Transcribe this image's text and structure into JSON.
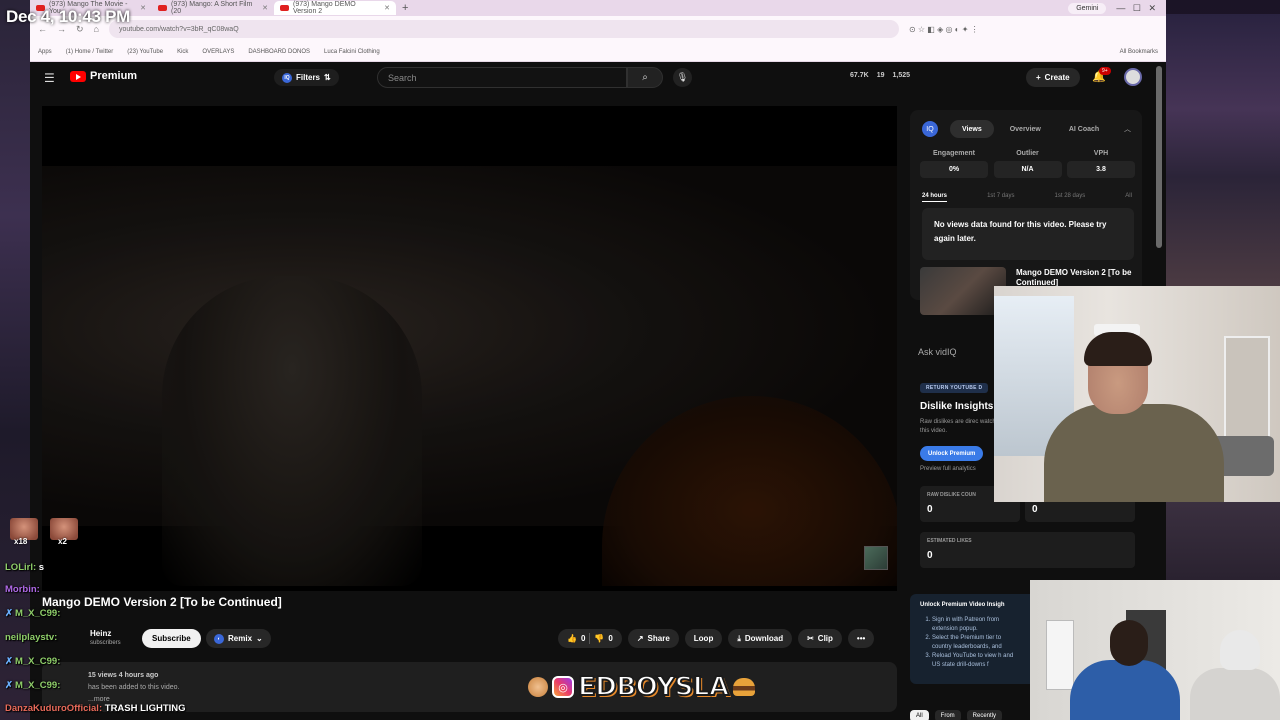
{
  "overlay": {
    "timestamp": "Dec 4, 10:43 PM"
  },
  "browser": {
    "tabs": [
      {
        "title": "(973) Mango The Movie - You",
        "active": false
      },
      {
        "title": "(973) Mango: A Short Film (20",
        "active": false
      },
      {
        "title": "(973) Mango DEMO Version 2",
        "active": true
      }
    ],
    "gemini": "Gemini",
    "url": "youtube.com/watch?v=3bR_qC08waQ",
    "bookmarks": [
      "Apps",
      "(1) Home / Twitter",
      "(23) YouTube",
      "Kick",
      "OVERLAYS",
      "DASHBOARD DONOS",
      "Luca Falcini Clothing"
    ],
    "all_bookmarks": "All Bookmarks"
  },
  "youtube": {
    "logo_text": "Premium",
    "filters_label": "Filters",
    "search_placeholder": "Search",
    "stats": [
      "67.7K",
      "19",
      "1,525"
    ],
    "create_label": "Create",
    "notif_count": "9+",
    "video_title": "Mango DEMO Version 2 [To be Continued]",
    "channel_name": "Heinz",
    "channel_subs": "subscribers",
    "subscribe_label": "Subscribe",
    "remix_label": "Remix",
    "like_count": "0",
    "dislike_count": "0",
    "share_label": "Share",
    "loop_label": "Loop",
    "download_label": "Download",
    "clip_label": "Clip",
    "description_meta": "15 views 4 hours ago",
    "description_text": "has been added to this video.",
    "description_more": "...more"
  },
  "vidiq": {
    "logo": "IQ",
    "tabs": [
      "Views",
      "Overview",
      "AI Coach"
    ],
    "metrics": [
      {
        "label": "Engagement",
        "value": "0%"
      },
      {
        "label": "Outlier",
        "value": "N/A"
      },
      {
        "label": "VPH",
        "value": "3.8"
      }
    ],
    "ranges": [
      "24 hours",
      "1st 7 days",
      "1st 28 days",
      "All"
    ],
    "message": "No views data found for this video. Please try again later."
  },
  "next_video": {
    "title": "Mango DEMO Version 2 [To be Continued]"
  },
  "ask_label": "Ask vidIQ",
  "dislike": {
    "tag": "RETURN YOUTUBE D",
    "title": "Dislike Insights",
    "desc": "Raw dislikes are direc watching this video.",
    "unlock_label": "Unlock Premium",
    "preview_label": "Preview full analytics",
    "raw_label": "RAW DISLIKE COUN",
    "raw_value_1": "0",
    "raw_value_2": "0",
    "est_label": "ESTIMATED LIKES",
    "est_value": "0"
  },
  "unlock_card": {
    "title": "Unlock Premium Video Insigh",
    "steps": [
      "Sign in with Patreon from extension popup.",
      "Select the Premium tier to country leaderboards, and",
      "Reload YouTube to view h and US state drill-downs f"
    ]
  },
  "chips": [
    "All",
    "From",
    "Recently"
  ],
  "chat": {
    "emote_counts": [
      "x18",
      "x2"
    ],
    "lines": [
      {
        "user": "LOLirl:",
        "msg": "s"
      },
      {
        "user": "Morbin:",
        "msg": ""
      },
      {
        "user": "M_X_C99:",
        "msg": ""
      },
      {
        "user": "neilplaystv:",
        "msg": ""
      },
      {
        "user": "M_X_C99:",
        "msg": ""
      },
      {
        "user": "M_X_C99:",
        "msg": ""
      },
      {
        "user": "DanzaKuduroOfficial:",
        "msg": "TRASH LIGHTING"
      }
    ]
  },
  "banner": {
    "text": "EDBOYSLA"
  }
}
